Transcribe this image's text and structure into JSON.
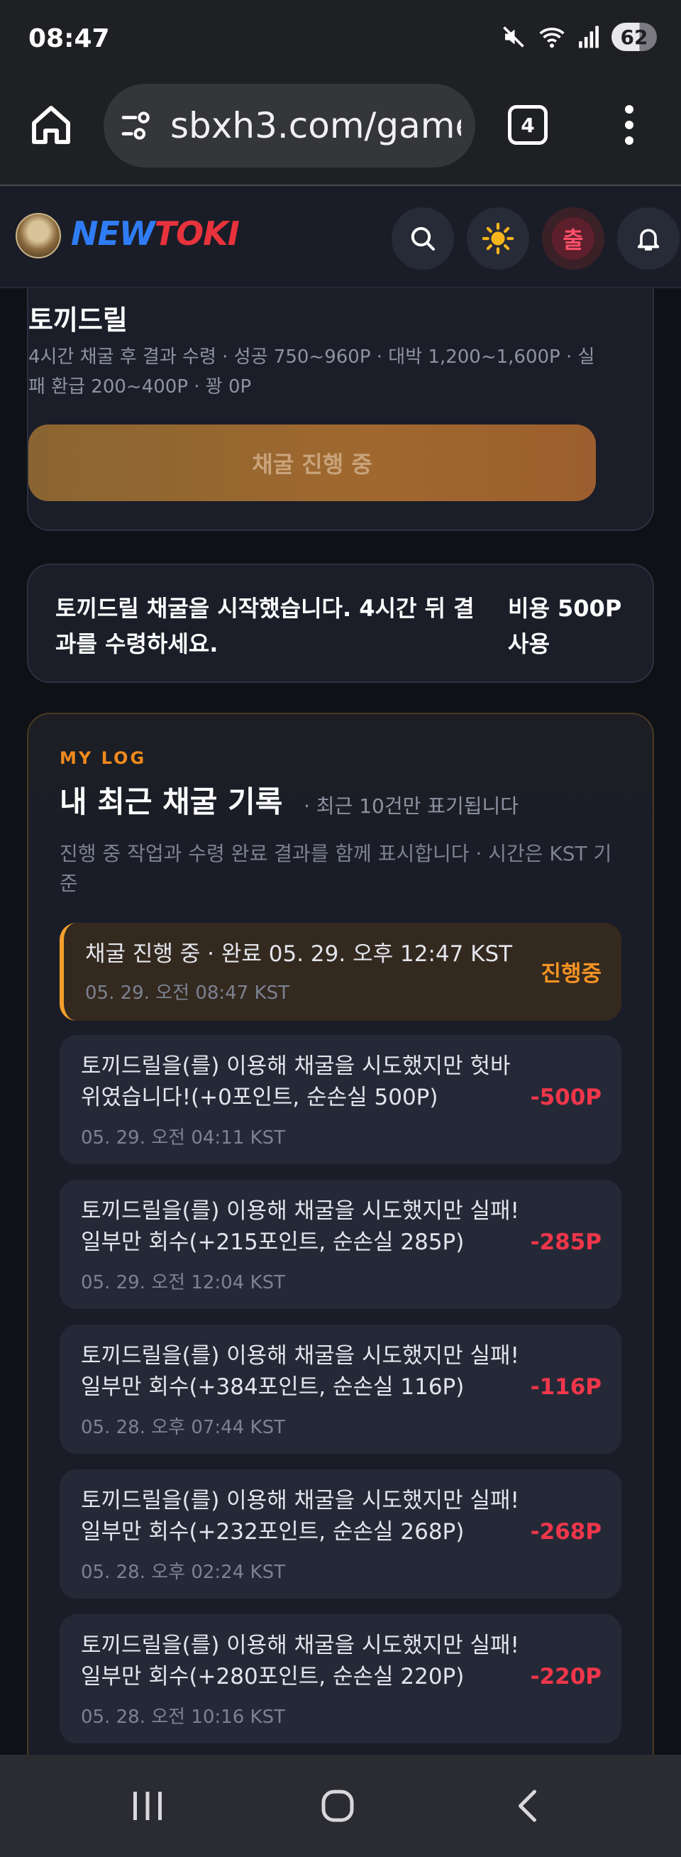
{
  "status_bar": {
    "time": "08:47",
    "battery": "62",
    "icons": [
      "mute-icon",
      "wifi-icon",
      "signal-icon",
      "battery-icon"
    ]
  },
  "browser": {
    "url": "sbxh3.com/game",
    "tab_count": "4"
  },
  "site": {
    "logo_new": "NEW",
    "logo_toki": "TOKI",
    "attend_label": "출"
  },
  "drill": {
    "title": "토끼드릴",
    "description": "4시간 채굴 후 결과 수령 · 성공 750~960P · 대박 1,200~1,600P · 실패 환급 200~400P · 꽝 0P",
    "button_label": "채굴 진행 중"
  },
  "notice": {
    "message": "토끼드릴 채굴을 시작했습니다. 4시간 뒤 결과를 수령하세요.",
    "cost": "비용 500P 사용"
  },
  "log": {
    "eyebrow": "MY LOG",
    "title": "내 최근 채굴 기록",
    "subtitle": "· 최근 10건만 표기됩니다",
    "description": "진행 중 작업과 수령 완료 결과를 함께 표시합니다 · 시간은 KST 기준",
    "entries": [
      {
        "text": "채굴 진행 중 · 완료 05. 29. 오후 12:47 KST",
        "time": "05. 29. 오전 08:47 KST",
        "amount": "진행중"
      },
      {
        "text": "토끼드릴을(를) 이용해 채굴을 시도했지만 헛바위였습니다!(+0포인트, 순손실 500P)",
        "time": "05. 29. 오전 04:11 KST",
        "amount": "-500P"
      },
      {
        "text": "토끼드릴을(를) 이용해 채굴을 시도했지만 실패! 일부만 회수(+215포인트, 순손실 285P)",
        "time": "05. 29. 오전 12:04 KST",
        "amount": "-285P"
      },
      {
        "text": "토끼드릴을(를) 이용해 채굴을 시도했지만 실패! 일부만 회수(+384포인트, 순손실 116P)",
        "time": "05. 28. 오후 07:44 KST",
        "amount": "-116P"
      },
      {
        "text": "토끼드릴을(를) 이용해 채굴을 시도했지만 실패! 일부만 회수(+232포인트, 순손실 268P)",
        "time": "05. 28. 오후 02:24 KST",
        "amount": "-268P"
      },
      {
        "text": "토끼드릴을(를) 이용해 채굴을 시도했지만 실패! 일부만 회수(+280포인트, 순손실 220P)",
        "time": "05. 28. 오전 10:16 KST",
        "amount": "-220P"
      }
    ]
  },
  "colors": {
    "accent_orange": "#f08a1c",
    "loss_red": "#f0364a",
    "logo_blue": "#2f7cf6",
    "logo_red": "#e8323c"
  }
}
